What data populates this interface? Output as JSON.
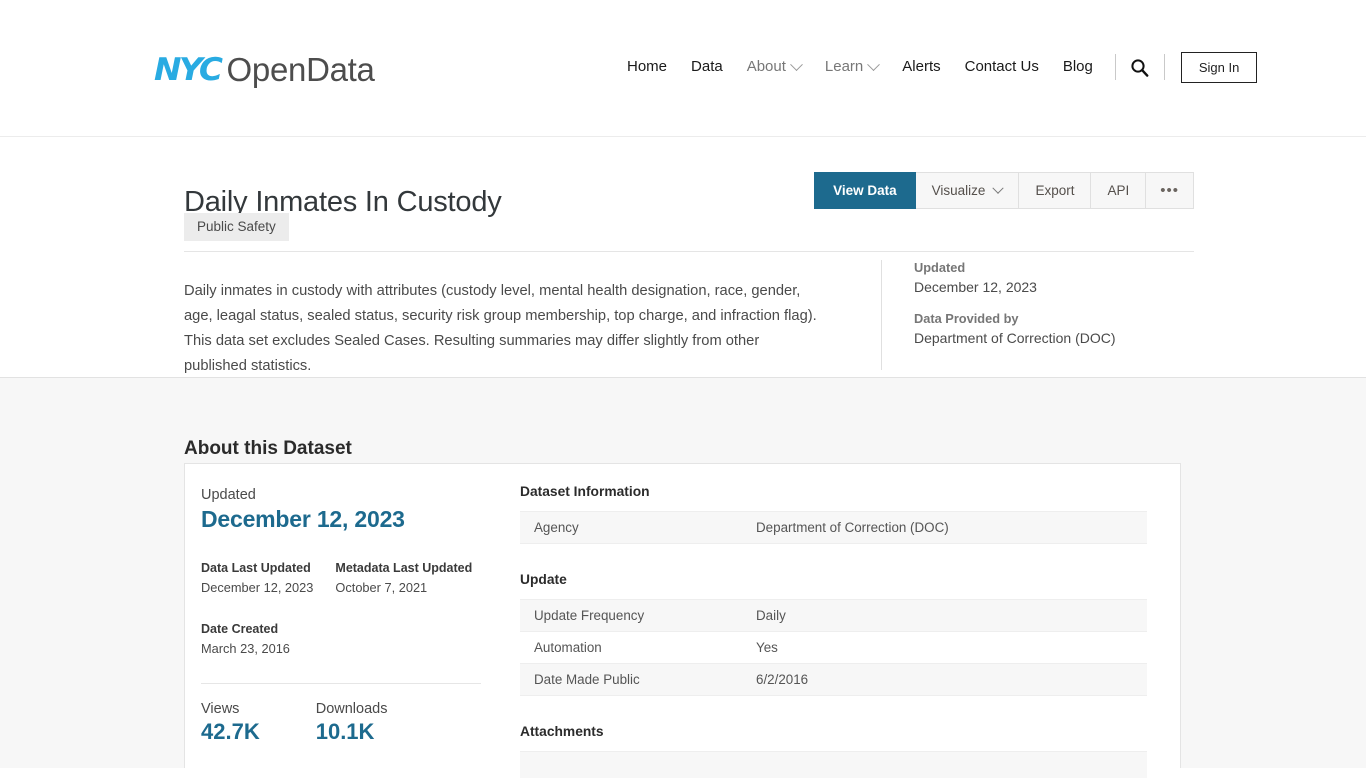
{
  "nav": {
    "logo": {
      "nyc": "NYC",
      "opendata": "OpenData"
    },
    "items": [
      {
        "label": "Home",
        "has_caret": false
      },
      {
        "label": "Data",
        "has_caret": false
      },
      {
        "label": "About",
        "has_caret": true
      },
      {
        "label": "Learn",
        "has_caret": true
      },
      {
        "label": "Alerts",
        "has_caret": false
      },
      {
        "label": "Contact Us",
        "has_caret": false
      },
      {
        "label": "Blog",
        "has_caret": false
      }
    ],
    "search_icon": "search-icon",
    "sign_in": "Sign In"
  },
  "dataset": {
    "title": "Daily Inmates In Custody",
    "tag": "Public Safety",
    "description": "Daily inmates in custody with attributes (custody level, mental health designation, race, gender, age, leagal status, sealed status, security risk group membership, top charge, and infraction flag). This data set excludes Sealed Cases. Resulting summaries may differ slightly from other published statistics.",
    "meta": [
      {
        "label": "Updated",
        "value": "December 12, 2023"
      },
      {
        "label": "Data Provided by",
        "value": "Department of Correction (DOC)"
      }
    ],
    "actions": [
      {
        "label": "View Data",
        "primary": true,
        "caret": false
      },
      {
        "label": "Visualize",
        "primary": false,
        "caret": true
      },
      {
        "label": "Export",
        "primary": false,
        "caret": false
      },
      {
        "label": "API",
        "primary": false,
        "caret": false
      },
      {
        "label": "•••",
        "primary": false,
        "caret": false,
        "ellipsis": true
      }
    ]
  },
  "about": {
    "heading": "About this Dataset",
    "updated_label": "Updated",
    "updated_value": "December 12, 2023",
    "data_last_updated": {
      "label": "Data Last Updated",
      "value": "December 12, 2023"
    },
    "metadata_last_updated": {
      "label": "Metadata Last Updated",
      "value": "October 7, 2021"
    },
    "date_created": {
      "label": "Date Created",
      "value": "March 23, 2016"
    },
    "views": {
      "label": "Views",
      "value": "42.7K"
    },
    "downloads": {
      "label": "Downloads",
      "value": "10.1K"
    },
    "sections": {
      "dataset_information": {
        "heading": "Dataset Information",
        "rows": [
          {
            "key": "Agency",
            "value": "Department of Correction (DOC)"
          }
        ]
      },
      "update": {
        "heading": "Update",
        "rows": [
          {
            "key": "Update Frequency",
            "value": "Daily"
          },
          {
            "key": "Automation",
            "value": "Yes"
          },
          {
            "key": "Date Made Public",
            "value": "6/2/2016"
          }
        ]
      },
      "attachments": {
        "heading": "Attachments",
        "rows": []
      }
    }
  },
  "colors": {
    "accent_blue": "#1d6a8e",
    "logo_cyan": "#29ABE2",
    "page_bg": "#f7f7f7",
    "tag_bg": "#ececec"
  }
}
